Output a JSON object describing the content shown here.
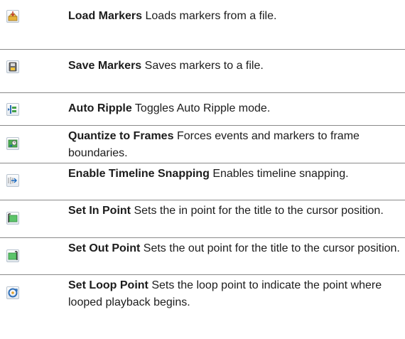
{
  "rows": [
    {
      "icon": "load-markers-icon",
      "name": "Load Markers",
      "text": "Loads markers from a file."
    },
    {
      "icon": "save-markers-icon",
      "name": "Save Markers",
      "text": "Saves markers to a file."
    },
    {
      "icon": "auto-ripple-icon",
      "name": "Auto Ripple",
      "text": "Toggles Auto Ripple mode."
    },
    {
      "icon": "quantize-to-frames-icon",
      "name": "Quantize to Frames",
      "text": "Forces events and markers to frame boundaries."
    },
    {
      "icon": "timeline-snapping-icon",
      "name": "Enable Timeline Snapping",
      "text": "Enables timeline snapping."
    },
    {
      "icon": "set-in-point-icon",
      "name": "Set In Point",
      "text": "Sets the in point for the title to the cursor position."
    },
    {
      "icon": "set-out-point-icon",
      "name": "Set Out Point",
      "text": "Sets the out point for the title to the cursor position."
    },
    {
      "icon": "set-loop-point-icon",
      "name": "Set Loop Point",
      "text": "Sets the loop point to indicate the point where looped playback begins."
    }
  ]
}
